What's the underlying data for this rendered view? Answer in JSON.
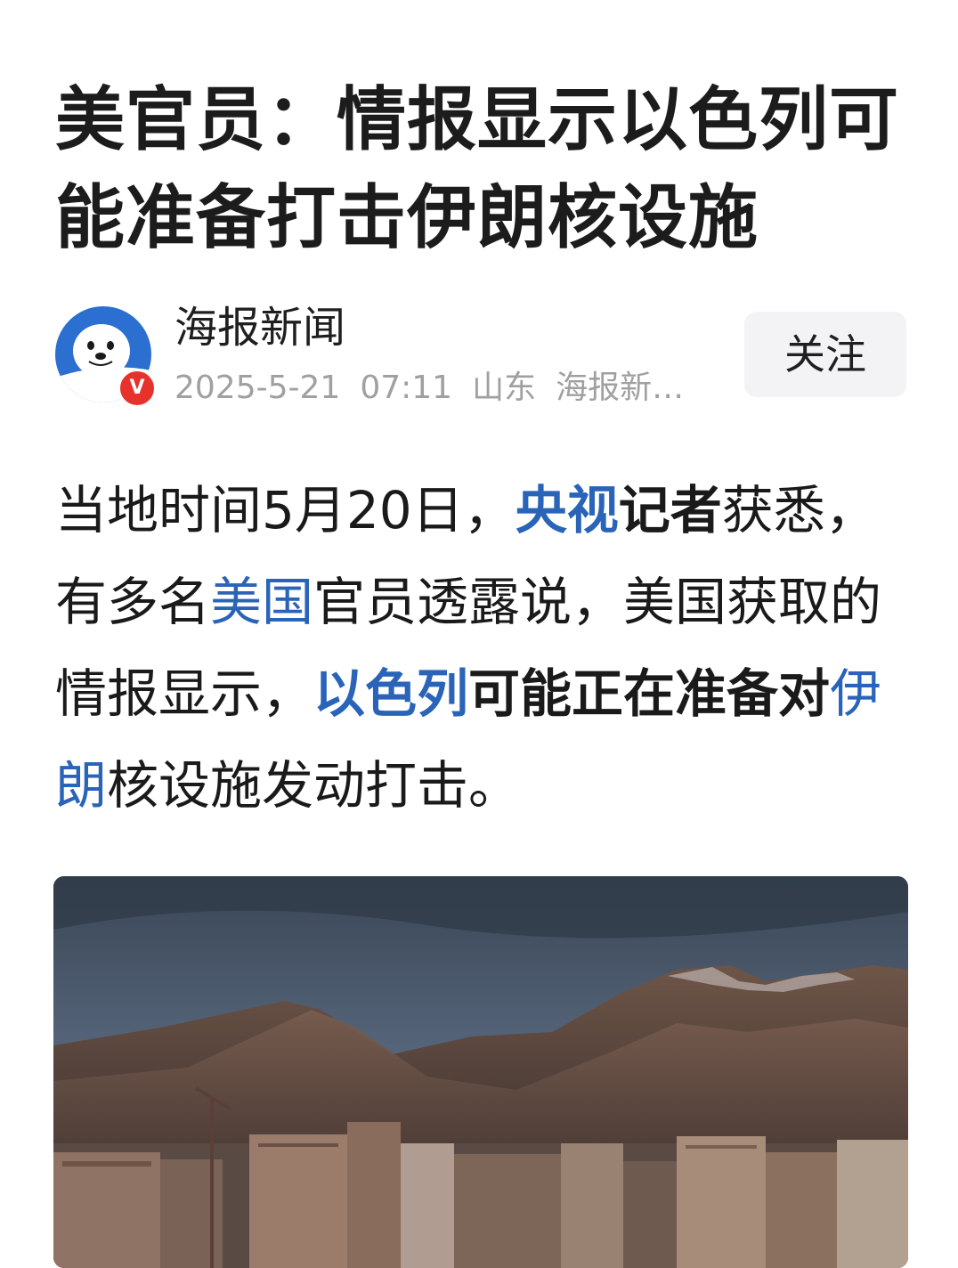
{
  "article": {
    "title": "美官员：情报显示以色列可能准备打击伊朗核设施",
    "author": {
      "name": "海报新闻",
      "verified_badge": "V",
      "avatar_icon": "seal-mascot-icon",
      "date": "2025-5-21",
      "time": "07:11",
      "location": "山东",
      "source": "海报新…"
    },
    "follow_label": "关注",
    "body": {
      "p1": "当地时间5月20日，",
      "link_cctv": "央视",
      "p2": "记者",
      "p3": "获悉，有多名",
      "link_us": "美国",
      "p4": "官员透露说，美国获取的情报显示，",
      "link_israel": "以色列",
      "p5": "可能正在准备对",
      "link_iran": "伊朗",
      "p6": "核设施发动打击。"
    },
    "image_subject": "city-skyline-mountains-photo"
  },
  "colors": {
    "link": "#2a64b8",
    "badge": "#e7322b",
    "avatar_bg": "#2b6fd0",
    "follow_bg": "#f3f3f5",
    "meta_text": "#a0a0a0"
  }
}
